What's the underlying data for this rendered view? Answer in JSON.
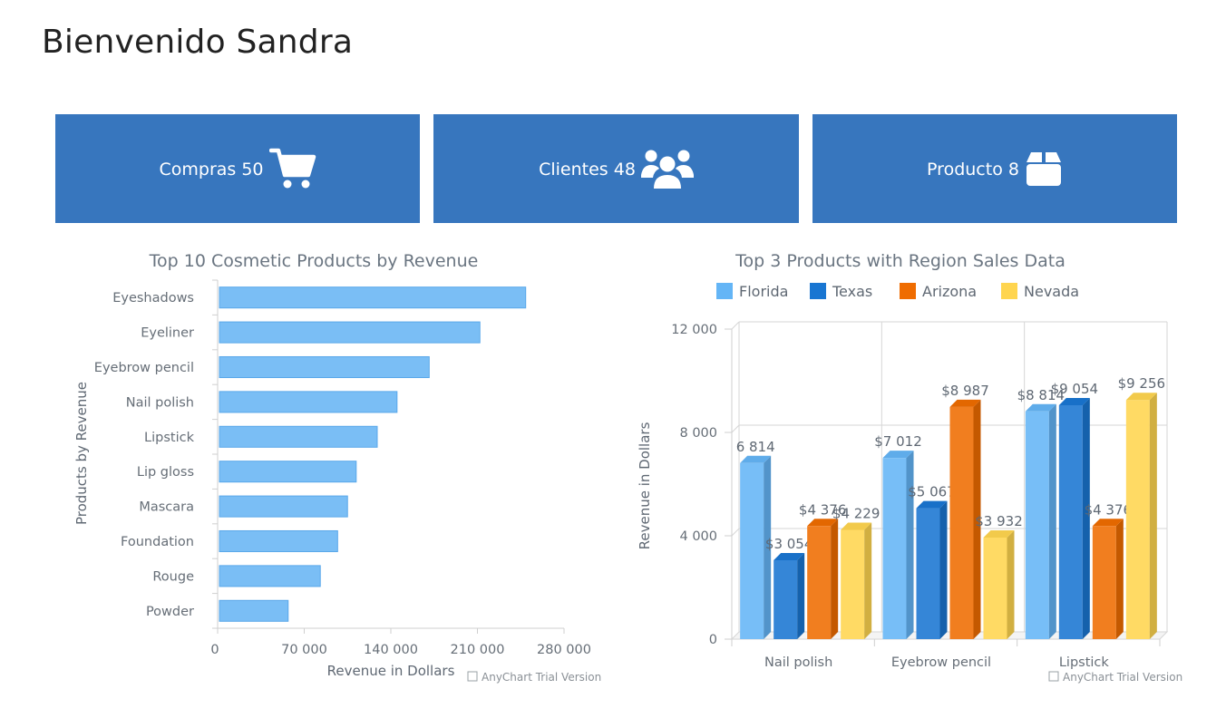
{
  "header": {
    "title": "Bienvenido Sandra"
  },
  "cards": [
    {
      "label": "Compras 50",
      "icon": "shopping-cart-icon"
    },
    {
      "label": "Clientes 48",
      "icon": "users-group-icon"
    },
    {
      "label": "Producto 8",
      "icon": "box-icon"
    }
  ],
  "colors": {
    "card_bg": "#3776be",
    "bar_fill": "#7abef5",
    "florida": "#64b5f6",
    "texas": "#1976d2",
    "arizona": "#ef6c00",
    "nevada": "#ffd54f"
  },
  "chart_data": [
    {
      "type": "bar",
      "orientation": "horizontal",
      "title": "Top 10 Cosmetic Products by Revenue",
      "xlabel": "Revenue in Dollars",
      "ylabel": "Products by Revenue",
      "categories": [
        "Eyeshadows",
        "Eyeliner",
        "Eyebrow pencil",
        "Nail polish",
        "Lipstick",
        "Lip gloss",
        "Mascara",
        "Foundation",
        "Rouge",
        "Powder"
      ],
      "values": [
        249000,
        212000,
        171000,
        145000,
        129000,
        112000,
        105000,
        97000,
        83000,
        57000
      ],
      "xlim": [
        0,
        280000
      ],
      "ticks": [
        "0",
        "70 000",
        "140 000",
        "210 000",
        "280 000"
      ],
      "watermark": "AnyChart Trial Version",
      "grid": false
    },
    {
      "type": "bar",
      "style": "3d-column",
      "title": "Top 3 Products with Region Sales Data",
      "xlabel": "",
      "ylabel": "Revenue in Dollars",
      "categories": [
        "Nail polish",
        "Eyebrow pencil",
        "Lipstick"
      ],
      "series": [
        {
          "name": "Florida",
          "values": [
            6814,
            7012,
            8814
          ],
          "labels": [
            "6 814",
            "$7 012",
            "$8 814"
          ]
        },
        {
          "name": "Texas",
          "values": [
            3054,
            5067,
            9054
          ],
          "labels": [
            "$3 054",
            "$5 067",
            "$9 054"
          ]
        },
        {
          "name": "Arizona",
          "values": [
            4376,
            8987,
            4376
          ],
          "labels": [
            "$4 376",
            "$8 987",
            "$4 376"
          ]
        },
        {
          "name": "Nevada",
          "values": [
            4229,
            3932,
            9256
          ],
          "labels": [
            "$4 229",
            "$3 932",
            "$9 256"
          ]
        }
      ],
      "ylim": [
        0,
        12000
      ],
      "ticks": [
        "0",
        "4 000",
        "8 000",
        "12 000"
      ],
      "legend": "top",
      "grid": true,
      "watermark": "AnyChart Trial Version"
    }
  ]
}
